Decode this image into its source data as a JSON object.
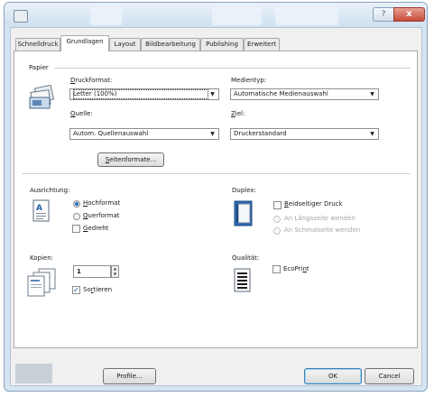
{
  "window": {
    "help_glyph": "?",
    "close_glyph": "x"
  },
  "tabs": [
    {
      "label": "Schnelldruck",
      "active": false
    },
    {
      "label": "Grundlagen",
      "active": true
    },
    {
      "label": "Layout",
      "active": false
    },
    {
      "label": "Bildbearbeitung",
      "active": false
    },
    {
      "label": "Publishing",
      "active": false
    },
    {
      "label": "Erweitert",
      "active": false
    }
  ],
  "papier": {
    "heading": "Papier",
    "druckformat_label": "Druckformat:",
    "druckformat_value": "Letter (100%)",
    "medientyp_label": "Medientyp:",
    "medientyp_value": "Automatische Medienauswahl",
    "quelle_label": "Quelle:",
    "quelle_value": "Autom. Quellenauswahl",
    "ziel_label": "Ziel:",
    "ziel_value": "Druckerstandard",
    "seitenformate_button": "Seitenformate..."
  },
  "ausrichtung": {
    "label": "Ausrichtung:",
    "hochformat": "Hochformat",
    "querformat": "Querformat",
    "gedreht": "Gedreht",
    "selected": "Hochformat",
    "gedreht_checked": false
  },
  "duplex": {
    "label": "Duplex:",
    "beidseitiger_druck": "Beidseitiger Druck",
    "laengsseite": "An Längsseite wenden",
    "schmalseite": "An Schmalseite wenden",
    "checked": false
  },
  "kopien": {
    "label": "Kopien:",
    "value": "1",
    "sortieren": "Sortieren",
    "sortieren_checked": true
  },
  "qualitaet": {
    "label": "Qualität:",
    "ecoprint": "EcoPrint",
    "ecoprint_checked": false
  },
  "footer": {
    "profile_button": "Profile...",
    "ok_button": "OK",
    "cancel_button": "Cancel"
  },
  "icons": {
    "checkmark": "✓",
    "dropdown_arrow": "▼",
    "spin_up": "▲",
    "spin_down": "▼"
  },
  "colors": {
    "accent": "#1f6fc0",
    "titlebar": "#cfe0f0",
    "close_button": "#c64a3a"
  }
}
